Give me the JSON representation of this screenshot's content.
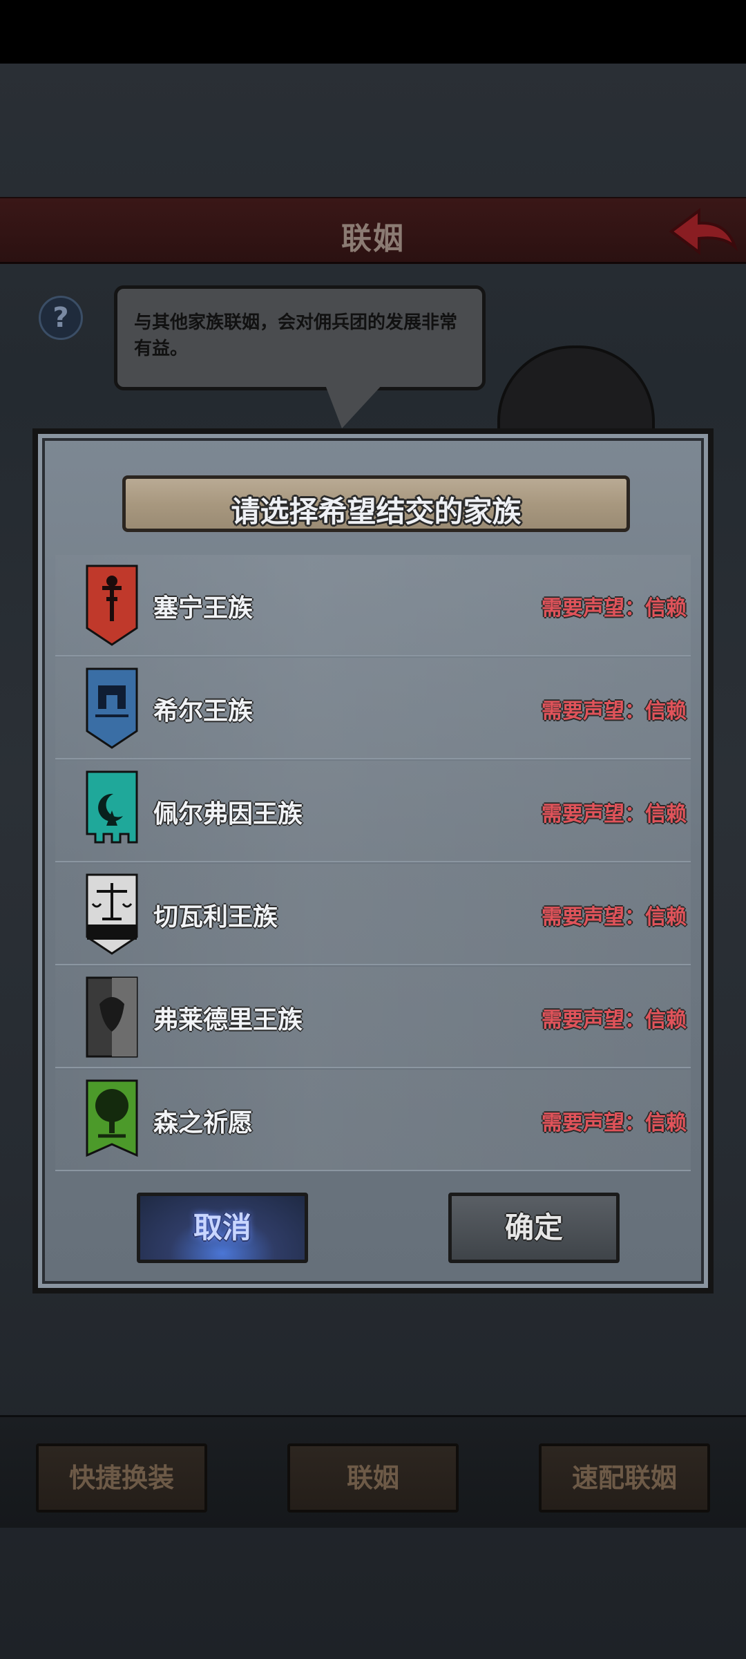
{
  "header": {
    "title": "联姻"
  },
  "speech": {
    "text": "与其他家族联姻，会对佣兵团的发展非常有益。"
  },
  "help": {
    "label": "?"
  },
  "modal": {
    "title": "请选择希望结交的家族",
    "families": [
      {
        "name": "塞宁王族",
        "requirement": "需要声望：信赖",
        "crest_color": "#c0392b",
        "icon": "sword-crest-icon"
      },
      {
        "name": "希尔王族",
        "requirement": "需要声望：信赖",
        "crest_color": "#3a6ea5",
        "icon": "castle-crest-icon"
      },
      {
        "name": "佩尔弗因王族",
        "requirement": "需要声望：信赖",
        "crest_color": "#1fa89a",
        "icon": "moon-crest-icon"
      },
      {
        "name": "切瓦利王族",
        "requirement": "需要声望：信赖",
        "crest_color": "#d9d9d9",
        "icon": "scales-crest-icon"
      },
      {
        "name": "弗莱德里王族",
        "requirement": "需要声望：信赖",
        "crest_color": "#3a3a3a",
        "icon": "bull-crest-icon"
      },
      {
        "name": "森之祈愿",
        "requirement": "需要声望：信赖",
        "crest_color": "#4c9a2a",
        "icon": "tree-crest-icon"
      }
    ],
    "cancel_label": "取消",
    "confirm_label": "确定"
  },
  "bottom_bar": {
    "quick_equip": "快捷换装",
    "marriage": "联姻",
    "quick_match": "速配联姻"
  }
}
